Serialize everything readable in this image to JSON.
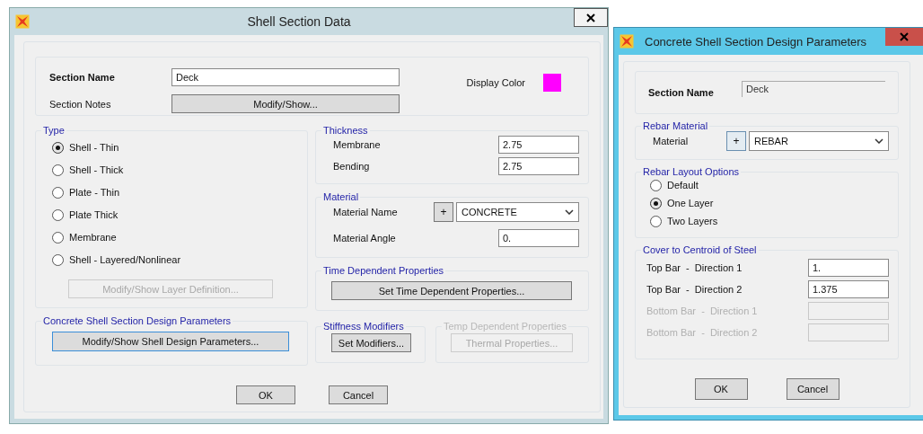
{
  "shell_section_data": {
    "title": "Shell Section Data",
    "section": {
      "name_label": "Section Name",
      "name_value": "Deck",
      "notes_label": "Section Notes",
      "notes_button": "Modify/Show...",
      "display_color_label": "Display Color",
      "color": "#ff00ff"
    },
    "type": {
      "title": "Type",
      "options": [
        {
          "label": "Shell - Thin",
          "selected": true
        },
        {
          "label": "Shell - Thick",
          "selected": false
        },
        {
          "label": "Plate - Thin",
          "selected": false
        },
        {
          "label": "Plate Thick",
          "selected": false
        },
        {
          "label": "Membrane",
          "selected": false
        },
        {
          "label": "Shell - Layered/Nonlinear",
          "selected": false
        }
      ],
      "layer_button": {
        "label": "Modify/Show Layer Definition...",
        "disabled": true
      }
    },
    "design": {
      "title": "Concrete Shell Section Design Parameters",
      "button": "Modify/Show Shell Design Parameters..."
    },
    "thickness": {
      "title": "Thickness",
      "rows": [
        {
          "label": "Membrane",
          "value": "2.75"
        },
        {
          "label": "Bending",
          "value": "2.75"
        }
      ]
    },
    "material": {
      "title": "Material",
      "name_label": "Material Name",
      "add_button": "+",
      "value": "CONCRETE",
      "angle_label": "Material Angle",
      "angle_value": "0."
    },
    "time_dependent": {
      "title": "Time Dependent Properties",
      "button": "Set Time Dependent Properties..."
    },
    "stiffness": {
      "title": "Stiffness Modifiers",
      "button": "Set Modifiers..."
    },
    "temp": {
      "title": "Temp Dependent Properties",
      "button": "Thermal Properties...",
      "disabled": true
    },
    "buttons": [
      "OK",
      "Cancel"
    ]
  },
  "design_parameters": {
    "title": "Concrete Shell Section Design Parameters",
    "section_name_label": "Section Name",
    "section_name_value": "Deck",
    "rebar_material": {
      "title": "Rebar Material",
      "label": "Material",
      "add_button": "+",
      "value": "REBAR"
    },
    "layout": {
      "title": "Rebar Layout Options",
      "options": [
        {
          "label": "Default",
          "selected": false
        },
        {
          "label": "One Layer",
          "selected": true
        },
        {
          "label": "Two Layers",
          "selected": false
        }
      ]
    },
    "cover": {
      "title": "Cover to Centroid of Steel",
      "rows": [
        {
          "label": "Top Bar  -  Direction 1",
          "value": "1.",
          "disabled": false
        },
        {
          "label": "Top Bar  -  Direction 2",
          "value": "1.375",
          "disabled": false
        },
        {
          "label": "Bottom Bar  -  Direction 1",
          "disabled": true
        },
        {
          "label": "Bottom Bar  -  Direction 2",
          "disabled": true
        }
      ]
    },
    "buttons": [
      "OK",
      "Cancel"
    ]
  }
}
